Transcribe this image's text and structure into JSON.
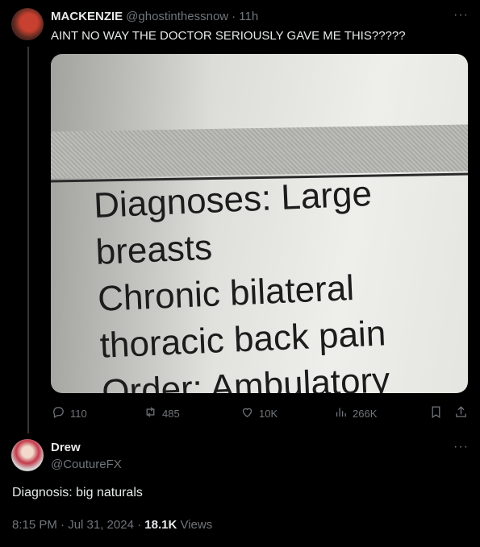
{
  "tweet": {
    "name": "MACKENZIE",
    "handle": "@ghostinthessnow",
    "time": "· 11h",
    "text": "AINT NO WAY THE DOCTOR SERIOUSLY GAVE ME THIS?????",
    "more": "···",
    "photo_text": [
      "Diagnoses: Large",
      "breasts",
      "Chronic bilateral",
      "thoracic back pain",
      "Order: Ambulatory"
    ],
    "stats": {
      "replies": "110",
      "retweets": "485",
      "likes": "10K",
      "views": "266K"
    }
  },
  "reply": {
    "name": "Drew",
    "handle": "@CoutureFX",
    "more": "···",
    "text": "Diagnosis: big naturals",
    "timestamp": "8:15 PM · Jul 31, 2024 ·",
    "views_count": "18.1K",
    "views_label": "Views"
  },
  "icons": [
    "reply-icon",
    "retweet-icon",
    "like-icon",
    "views-icon",
    "bookmark-icon",
    "share-icon"
  ],
  "colors": {
    "background": "#000000",
    "text": "#e7e9ea",
    "muted": "#71767b"
  }
}
